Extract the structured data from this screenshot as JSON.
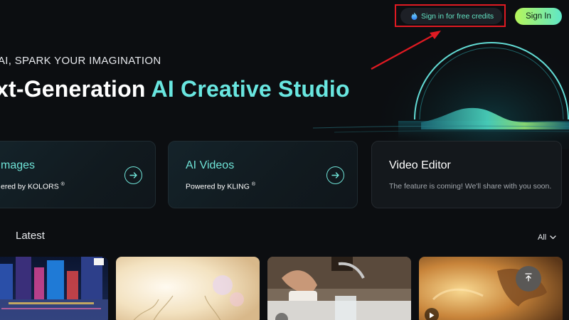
{
  "header": {
    "credits_label": "Sign in for free credits",
    "signin_label": "Sign In"
  },
  "hero": {
    "kicker": "AI, SPARK YOUR IMAGINATION",
    "title_plain": "xt-Generation ",
    "title_accent": "AI Creative Studio"
  },
  "cards": [
    {
      "title": "mages",
      "subtitle": "ered by KOLORS",
      "mark": "®"
    },
    {
      "title": "AI Videos",
      "subtitle": "Powered by KLING",
      "mark": "®"
    },
    {
      "title": "Video Editor",
      "subtitle": "The feature is coming! We'll share with you soon."
    }
  ],
  "latest": {
    "heading": "Latest",
    "filter_label": "All"
  },
  "colors": {
    "accent": "#69e6e0",
    "signin_start": "#b6f55a",
    "signin_end": "#5fe7c8",
    "highlight": "#e01a22",
    "background": "#0c0e11"
  },
  "icons": {
    "credits": "flame-drop-icon",
    "card_arrow": "arrow-right-circle-icon",
    "filter_chevron": "chevron-down-icon",
    "play": "play-icon",
    "scroll_top": "arrow-up-icon"
  }
}
